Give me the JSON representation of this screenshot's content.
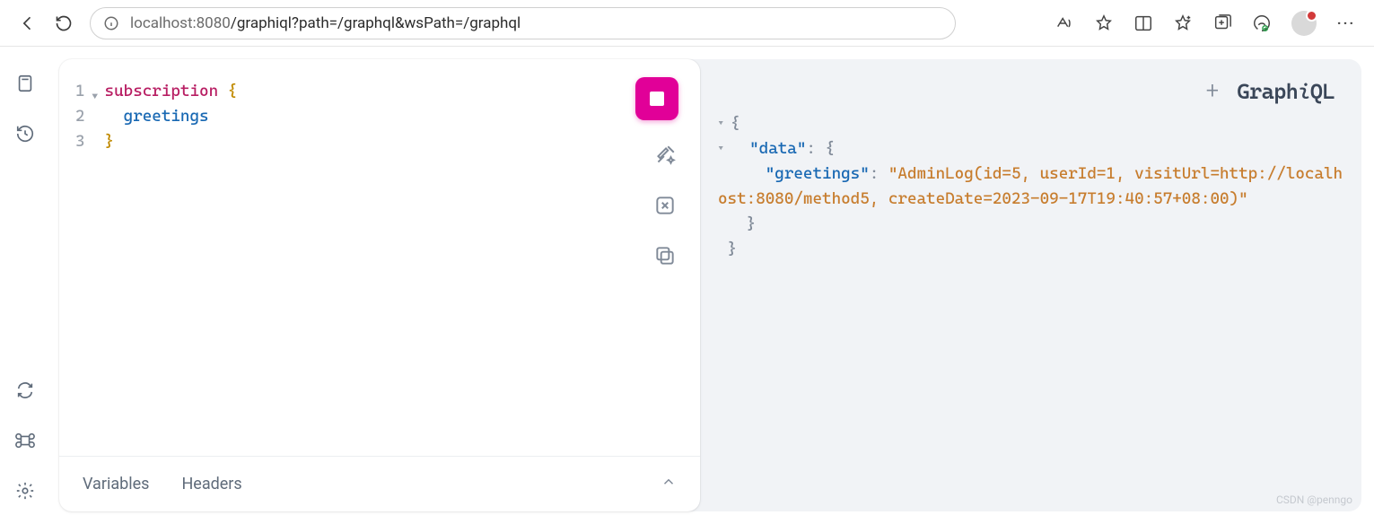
{
  "browser": {
    "url_host": "localhost",
    "url_port": ":8080",
    "url_path": "/graphiql?path=/graphql&wsPath=/graphql"
  },
  "graphiql": {
    "logo_prefix": "Graph",
    "logo_i": "i",
    "logo_suffix": "QL",
    "add_tab_glyph": "+"
  },
  "editor": {
    "lines": {
      "l1_keyword": "subscription",
      "l1_brace": " {",
      "l2_field": "greetings",
      "l3_brace": "}"
    },
    "line_numbers": [
      "1",
      "2",
      "3"
    ],
    "footer_tabs": {
      "variables": "Variables",
      "headers": "Headers"
    }
  },
  "response": {
    "open_brace": "{",
    "data_key": "\"data\"",
    "colon_open": ": {",
    "greetings_key": "\"greetings\"",
    "colon": ": ",
    "greetings_value": "\"AdminLog(id=5, userId=1, visitUrl=http://localhost:8080/method5, createDate=2023-09-17T19:40:57+08:00)\"",
    "close_inner": "}",
    "close_outer": "}"
  },
  "watermark": "CSDN @penngo"
}
